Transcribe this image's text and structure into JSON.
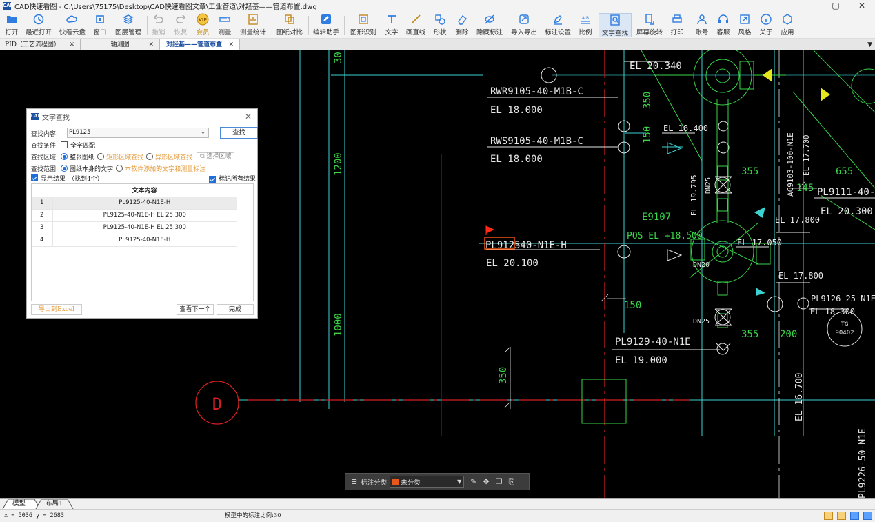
{
  "window": {
    "app_icon_text": "CAD",
    "title": "CAD快速看图 - C:\\Users\\75175\\Desktop\\CAD快速看图文章\\工业管道\\对羟基——管道布置.dwg",
    "minimize": "—",
    "maximize": "▢",
    "close": "✕"
  },
  "toolbar": {
    "items": [
      {
        "label": "打开",
        "icon": "folder-icon"
      },
      {
        "label": "最近打开",
        "icon": "clock-icon"
      },
      {
        "label": "快看云盘",
        "icon": "cloud-icon"
      },
      {
        "label": "窗口",
        "icon": "window-icon"
      },
      {
        "label": "图层管理",
        "icon": "layers-icon"
      },
      {
        "label": "撤销",
        "icon": "undo-icon"
      },
      {
        "label": "恢复",
        "icon": "redo-icon"
      },
      {
        "label": "会员",
        "icon": "vip-icon"
      },
      {
        "label": "测量",
        "icon": "ruler-icon"
      },
      {
        "label": "测量统计",
        "icon": "stats-icon"
      },
      {
        "label": "图纸对比",
        "icon": "compare-icon"
      },
      {
        "label": "编辑助手",
        "icon": "edit-helper-icon"
      },
      {
        "label": "图形识别",
        "icon": "shape-recognize-icon"
      },
      {
        "label": "文字",
        "icon": "text-icon"
      },
      {
        "label": "画直线",
        "icon": "line-icon"
      },
      {
        "label": "形状",
        "icon": "shape-icon"
      },
      {
        "label": "删除",
        "icon": "eraser-icon"
      },
      {
        "label": "隐藏标注",
        "icon": "hide-annotation-icon"
      },
      {
        "label": "导入导出",
        "icon": "import-export-icon"
      },
      {
        "label": "标注设置",
        "icon": "annotation-settings-icon"
      },
      {
        "label": "比例",
        "icon": "scale-icon"
      },
      {
        "label": "文字查找",
        "icon": "text-search-icon"
      },
      {
        "label": "屏幕旋转",
        "icon": "rotate-screen-icon"
      },
      {
        "label": "打印",
        "icon": "print-icon"
      },
      {
        "label": "账号",
        "icon": "account-icon"
      },
      {
        "label": "客服",
        "icon": "headset-icon"
      },
      {
        "label": "风格",
        "icon": "style-icon"
      },
      {
        "label": "关于",
        "icon": "info-icon"
      },
      {
        "label": "应用",
        "icon": "apps-icon"
      }
    ],
    "vip_badge": "VIP",
    "scale_glyph": "A:B"
  },
  "tabs": [
    {
      "label": "PID（工艺流程图）",
      "close": "✕"
    },
    {
      "label": "轴测图",
      "close": "✕"
    },
    {
      "label": "对羟基——管道布置",
      "close": "✕"
    }
  ],
  "tab_menu": "▼",
  "drawing": {
    "texts": {
      "el20340": "EL 20.340",
      "rwr": "RWR9105-40-M1B-C",
      "el18000a": "EL 18.000",
      "rws": "RWS9105-40-M1B-C",
      "el18000b": "EL 18.000",
      "d30": "30",
      "d350a": "350",
      "d150a": "150",
      "el18400": "EL 18.400",
      "d1200": "1200",
      "d1000": "1000",
      "d350b": "350",
      "ac9103": "AC9103-100-N1E",
      "el17700": "EL 17.700",
      "d355a": "355",
      "d655": "655",
      "d145": "145",
      "pl9111": "PL9111-40-N1E-",
      "el20300": "EL 20.300",
      "dn25a": "DN25",
      "el19795": "EL 19.795",
      "e9107": "E9107",
      "el17800a": "EL 17.800",
      "pos": "POS EL +18.500",
      "el17050": "EL 17.050",
      "pl9125_hit": "PL9125",
      "pl9125_rest": "-40-N1E-H",
      "el20100": "EL 20.100",
      "dn20": "DN20",
      "el17800b": "EL 17.800",
      "d150b": "150",
      "dn25b": "DN25",
      "pl9126": "PL9126-25-N1E",
      "el18300": "EL 18.300",
      "tg1": "TG",
      "tg2": "90402",
      "d355b": "355",
      "d200": "200",
      "pl9129": "PL9129-40-N1E",
      "el19000": "EL 19.000",
      "grid_d": "D",
      "el16700": "EL 16.700",
      "pl9226": "PL9226-50-N1E"
    }
  },
  "dialog": {
    "icon_text": "CAD",
    "title": "文字查找",
    "close": "✕",
    "find_content_label": "查找内容:",
    "find_value": "PL9125",
    "combo_arrow": "⌄",
    "find_button": "查找",
    "condition_label": "查找条件:",
    "full_match": "全字匹配",
    "area_label": "查找区域:",
    "area_opt1": "整张图纸",
    "area_opt2": "矩形区域查找",
    "area_opt3": "异形区域查找",
    "select_area": "选择区域",
    "range_label": "查找范围:",
    "range_opt1": "图纸本身的文字",
    "range_opt2": "本软件添加的文字和测量标注",
    "show_results": "显示结果",
    "found_count": "（找到4个）",
    "mark_all": "标记所有结果",
    "table_header": "文本内容",
    "results": [
      {
        "num": "1",
        "text": "PL9125-40-N1E-H"
      },
      {
        "num": "2",
        "text": "PL9125-40-N1E-H EL 25.300"
      },
      {
        "num": "3",
        "text": "PL9125-40-N1E-H EL 25.300"
      },
      {
        "num": "4",
        "text": "PL9125-40-N1E-H"
      }
    ],
    "export_excel": "导出到Excel",
    "find_next": "查看下一个",
    "done": "完成"
  },
  "annotation_bar": {
    "grid_icon": "⊞",
    "label": "标注分类",
    "category": "未分类",
    "arrow": "▼",
    "category_color": "#e8581a"
  },
  "layouts": [
    {
      "label": "模型"
    },
    {
      "label": "布局1"
    }
  ],
  "status": {
    "coords": "x = 5036  y = 2683",
    "scale_text": "模型中的标注比例:30"
  },
  "colors": {
    "cad_green": "#3ad54a",
    "cad_cyan": "#3cd2d2",
    "cad_red": "#d42020",
    "cad_white": "#e6e6e6",
    "cad_yellow": "#e6e61e",
    "highlight": "#ff5a14",
    "accent_blue": "#1e6fd9"
  }
}
